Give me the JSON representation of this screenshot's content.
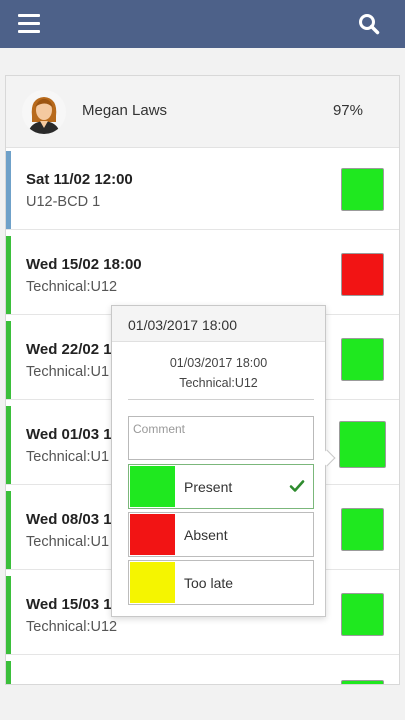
{
  "header": {
    "menu_icon": "hamburger-menu-icon",
    "search_icon": "search-icon",
    "color": "#4d6189"
  },
  "user": {
    "name": "Megan Laws",
    "attendance": "97%"
  },
  "events": [
    {
      "date": "Sat 11/02 12:00",
      "subtitle": "U12-BCD 1",
      "status": "present",
      "status_color": "#1fe81f",
      "bar_color": "#6fa1c9"
    },
    {
      "date": "Wed 15/02 18:00",
      "subtitle": "Technical:U12",
      "status": "absent",
      "status_color": "#f21414",
      "bar_color": "#3bbf3b"
    },
    {
      "date": "Wed 22/02 1",
      "subtitle": "Technical:U1",
      "status": "present",
      "status_color": "#1fe81f",
      "bar_color": "#3bbf3b"
    },
    {
      "date": "Wed 01/03 1",
      "subtitle": "Technical:U1",
      "status": "present",
      "status_color": "#1fe81f",
      "bar_color": "#3bbf3b"
    },
    {
      "date": "Wed 08/03 1",
      "subtitle": "Technical:U1",
      "status": "present",
      "status_color": "#1fe81f",
      "bar_color": "#3bbf3b"
    },
    {
      "date": "Wed 15/03 1",
      "subtitle": "Technical:U12",
      "status": "present",
      "status_color": "#1fe81f",
      "bar_color": "#3bbf3b"
    },
    {
      "date": "",
      "subtitle": "",
      "status": "present",
      "status_color": "#1fe81f",
      "bar_color": "#3bbf3b"
    }
  ],
  "popover": {
    "header": "01/03/2017 18:00",
    "date": "01/03/2017 18:00",
    "place": "Technical:U12",
    "comment_placeholder": "Comment",
    "comment_value": "",
    "options": [
      {
        "label": "Present",
        "color": "#1fe81f",
        "selected": true,
        "icon": "checkmark-icon"
      },
      {
        "label": "Absent",
        "color": "#f21414",
        "selected": false
      },
      {
        "label": "Too late",
        "color": "#f5f500",
        "selected": false
      }
    ]
  }
}
